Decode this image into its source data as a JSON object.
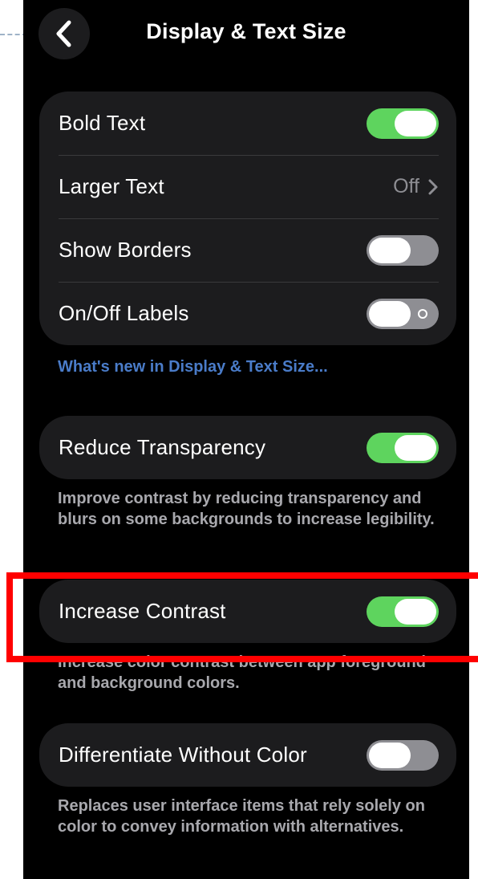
{
  "nav": {
    "title": "Display & Text Size",
    "back_icon": "chevron-left-icon"
  },
  "group1": {
    "bold_text": {
      "label": "Bold Text",
      "on": true
    },
    "larger_text": {
      "label": "Larger Text",
      "value": "Off"
    },
    "show_borders": {
      "label": "Show Borders",
      "on": false
    },
    "on_off_labels": {
      "label": "On/Off Labels",
      "on": false
    }
  },
  "link_text": "What's new in Display & Text Size...",
  "reduce_transparency": {
    "label": "Reduce Transparency",
    "on": true,
    "footer": "Improve contrast by reducing transparency and blurs on some backgrounds to increase legibility."
  },
  "increase_contrast": {
    "label": "Increase Contrast",
    "on": true,
    "footer": "Increase color contrast between app foreground and background colors."
  },
  "differentiate_without_color": {
    "label": "Differentiate Without Color",
    "on": false,
    "footer": "Replaces user interface items that rely solely on color to convey information with alternatives."
  },
  "colors": {
    "toggle_on": "#5ed45e",
    "toggle_off": "#8e8e93",
    "link": "#4a7cc9",
    "highlight": "#ff0000",
    "group_bg": "#1c1c1e"
  }
}
